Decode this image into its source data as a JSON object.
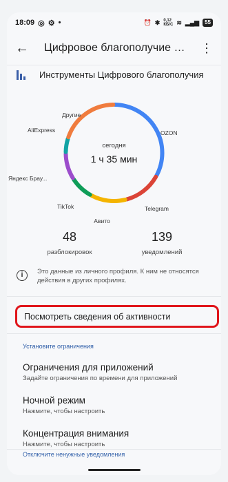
{
  "status_bar": {
    "time": "18:09",
    "speed": "0,12\nКБ/С",
    "battery": "55"
  },
  "app_bar": {
    "title": "Цифровое благополучие и ро..."
  },
  "header": {
    "title": "Инструменты Цифрового благополучия"
  },
  "donut": {
    "center_label": "сегодня",
    "center_value": "1 ч 35 мин",
    "segments": [
      {
        "label": "OZON",
        "color": "#4285f4",
        "fraction": 0.33
      },
      {
        "label": "Telegram",
        "color": "#db4437",
        "fraction": 0.13
      },
      {
        "label": "Авито",
        "color": "#f4b400",
        "fraction": 0.12
      },
      {
        "label": "TikTok",
        "color": "#0f9d58",
        "fraction": 0.08
      },
      {
        "label": "Яндекс Брау...",
        "color": "#9c4dcc",
        "fraction": 0.09
      },
      {
        "label": "AliExpress",
        "color": "#12a4a4",
        "fraction": 0.05
      },
      {
        "label": "Другие",
        "color": "#f07c3e",
        "fraction": 0.2
      }
    ]
  },
  "stats": {
    "unlocks_value": "48",
    "unlocks_label": "разблокировок",
    "notifications_value": "139",
    "notifications_label": "уведомлений"
  },
  "info_text": "Это данные из личного профиля. К ним не относятся действия в других профилях.",
  "activity_button": "Посмотреть сведения об активности",
  "section_limits": "Установите ограничения",
  "items": [
    {
      "title": "Ограничения для приложений",
      "subtitle": "Задайте ограничения по времени для приложений"
    },
    {
      "title": "Ночной режим",
      "subtitle": "Нажмите, чтобы настроить"
    },
    {
      "title": "Концентрация внимания",
      "subtitle": "Нажмите, чтобы настроить"
    }
  ],
  "section_notifications": "Отключите ненужные уведомления"
}
